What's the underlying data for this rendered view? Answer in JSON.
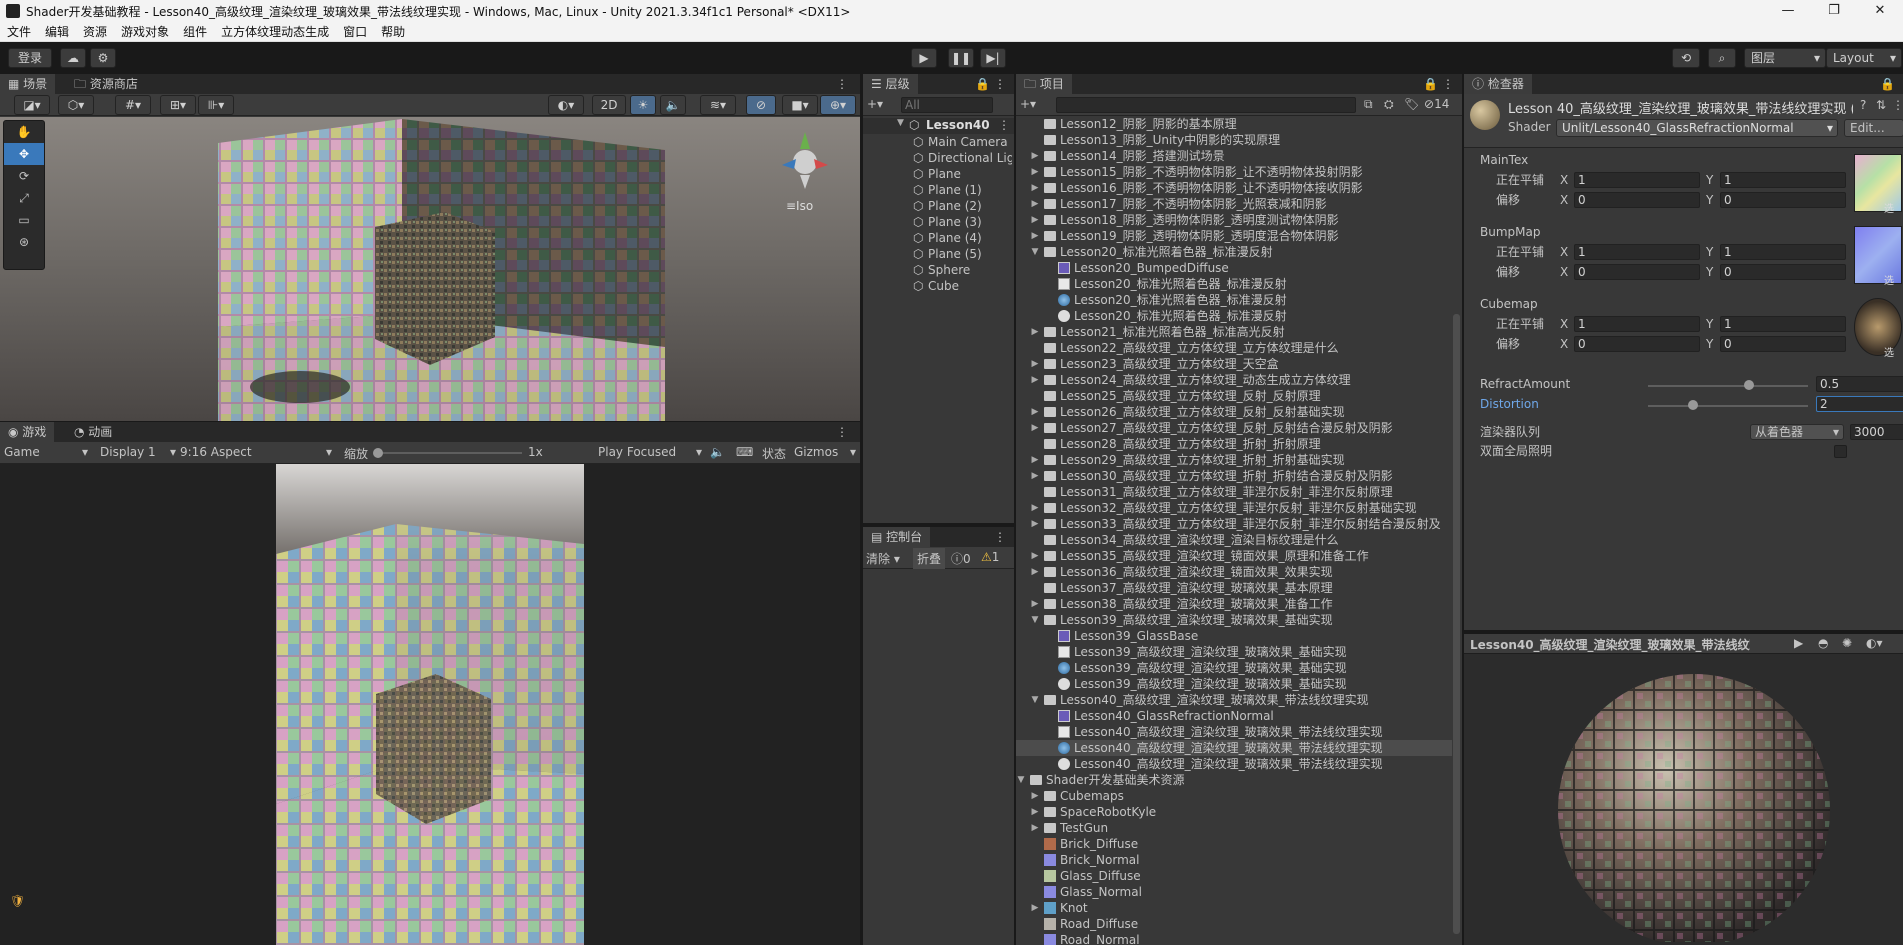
{
  "window": {
    "title": "Shader开发基础教程 - Lesson40_高级纹理_渲染纹理_玻璃效果_带法线纹理实现 - Windows, Mac, Linux - Unity 2021.3.34f1c1 Personal* <DX11>",
    "menu": [
      "文件",
      "编辑",
      "资源",
      "游戏对象",
      "组件",
      "立方体纹理动态生成",
      "窗口",
      "帮助"
    ]
  },
  "toolbar": {
    "login": "登录",
    "layers": "图层",
    "layout": "Layout"
  },
  "scene": {
    "tabs": [
      "场景",
      "资源商店"
    ],
    "mode_2d": "2D",
    "gizmo_label": "≡Iso",
    "search_placeholder": "All"
  },
  "game": {
    "tabs": [
      "游戏",
      "动画"
    ],
    "game_select": "Game",
    "display": "Display 1",
    "aspect": "9:16 Aspect",
    "scale_label": "缩放",
    "scale_value": "1x",
    "play_focused": "Play Focused",
    "stats": "状态",
    "gizmos": "Gizmos"
  },
  "hierarchy": {
    "tab": "层级",
    "search_placeholder": "All",
    "scene_name": "Lesson40",
    "items": [
      "Main Camera",
      "Directional Light",
      "Plane",
      "Plane (1)",
      "Plane (2)",
      "Plane (3)",
      "Plane (4)",
      "Plane (5)",
      "Sphere",
      "Cube"
    ]
  },
  "console": {
    "tab": "控制台",
    "clear": "清除",
    "collapse": "折叠",
    "errors": "0",
    "warnings": "1"
  },
  "project": {
    "tab": "项目",
    "hidden_count": "14",
    "rows": [
      {
        "d": 2,
        "fold": "",
        "icon": "folder",
        "text": "Lesson12_阴影_阴影的基本原理"
      },
      {
        "d": 2,
        "fold": "",
        "icon": "folder",
        "text": "Lesson13_阴影_Unity中阴影的实现原理"
      },
      {
        "d": 2,
        "fold": "▶",
        "icon": "folder",
        "text": "Lesson14_阴影_搭建测试场景"
      },
      {
        "d": 2,
        "fold": "▶",
        "icon": "folder",
        "text": "Lesson15_阴影_不透明物体阴影_让不透明物体投射阴影"
      },
      {
        "d": 2,
        "fold": "▶",
        "icon": "folder",
        "text": "Lesson16_阴影_不透明物体阴影_让不透明物体接收阴影"
      },
      {
        "d": 2,
        "fold": "▶",
        "icon": "folder",
        "text": "Lesson17_阴影_不透明物体阴影_光照衰减和阴影"
      },
      {
        "d": 2,
        "fold": "▶",
        "icon": "folder",
        "text": "Lesson18_阴影_透明物体阴影_透明度测试物体阴影"
      },
      {
        "d": 2,
        "fold": "▶",
        "icon": "folder",
        "text": "Lesson19_阴影_透明物体阴影_透明度混合物体阴影"
      },
      {
        "d": 2,
        "fold": "▼",
        "icon": "folder",
        "text": "Lesson20_标准光照着色器_标准漫反射"
      },
      {
        "d": 3,
        "fold": "",
        "icon": "shader",
        "text": "Lesson20_BumpedDiffuse"
      },
      {
        "d": 3,
        "fold": "",
        "icon": "script",
        "text": "Lesson20_标准光照着色器_标准漫反射"
      },
      {
        "d": 3,
        "fold": "",
        "icon": "material",
        "text": "Lesson20_标准光照着色器_标准漫反射"
      },
      {
        "d": 3,
        "fold": "",
        "icon": "scene",
        "text": "Lesson20_标准光照着色器_标准漫反射"
      },
      {
        "d": 2,
        "fold": "▶",
        "icon": "folder",
        "text": "Lesson21_标准光照着色器_标准高光反射"
      },
      {
        "d": 2,
        "fold": "",
        "icon": "folder",
        "text": "Lesson22_高级纹理_立方体纹理_立方体纹理是什么"
      },
      {
        "d": 2,
        "fold": "▶",
        "icon": "folder",
        "text": "Lesson23_高级纹理_立方体纹理_天空盒"
      },
      {
        "d": 2,
        "fold": "▶",
        "icon": "folder",
        "text": "Lesson24_高级纹理_立方体纹理_动态生成立方体纹理"
      },
      {
        "d": 2,
        "fold": "",
        "icon": "folder",
        "text": "Lesson25_高级纹理_立方体纹理_反射_反射原理"
      },
      {
        "d": 2,
        "fold": "▶",
        "icon": "folder",
        "text": "Lesson26_高级纹理_立方体纹理_反射_反射基础实现"
      },
      {
        "d": 2,
        "fold": "▶",
        "icon": "folder",
        "text": "Lesson27_高级纹理_立方体纹理_反射_反射结合漫反射及阴影"
      },
      {
        "d": 2,
        "fold": "",
        "icon": "folder",
        "text": "Lesson28_高级纹理_立方体纹理_折射_折射原理"
      },
      {
        "d": 2,
        "fold": "▶",
        "icon": "folder",
        "text": "Lesson29_高级纹理_立方体纹理_折射_折射基础实现"
      },
      {
        "d": 2,
        "fold": "▶",
        "icon": "folder",
        "text": "Lesson30_高级纹理_立方体纹理_折射_折射结合漫反射及阴影"
      },
      {
        "d": 2,
        "fold": "",
        "icon": "folder",
        "text": "Lesson31_高级纹理_立方体纹理_菲涅尔反射_菲涅尔反射原理"
      },
      {
        "d": 2,
        "fold": "▶",
        "icon": "folder",
        "text": "Lesson32_高级纹理_立方体纹理_菲涅尔反射_菲涅尔反射基础实现"
      },
      {
        "d": 2,
        "fold": "▶",
        "icon": "folder",
        "text": "Lesson33_高级纹理_立方体纹理_菲涅尔反射_菲涅尔反射结合漫反射及"
      },
      {
        "d": 2,
        "fold": "",
        "icon": "folder",
        "text": "Lesson34_高级纹理_渲染纹理_渲染目标纹理是什么"
      },
      {
        "d": 2,
        "fold": "▶",
        "icon": "folder",
        "text": "Lesson35_高级纹理_渲染纹理_镜面效果_原理和准备工作"
      },
      {
        "d": 2,
        "fold": "▶",
        "icon": "folder",
        "text": "Lesson36_高级纹理_渲染纹理_镜面效果_效果实现"
      },
      {
        "d": 2,
        "fold": "",
        "icon": "folder",
        "text": "Lesson37_高级纹理_渲染纹理_玻璃效果_基本原理"
      },
      {
        "d": 2,
        "fold": "▶",
        "icon": "folder",
        "text": "Lesson38_高级纹理_渲染纹理_玻璃效果_准备工作"
      },
      {
        "d": 2,
        "fold": "▼",
        "icon": "folder",
        "text": "Lesson39_高级纹理_渲染纹理_玻璃效果_基础实现"
      },
      {
        "d": 3,
        "fold": "",
        "icon": "shader",
        "text": "Lesson39_GlassBase"
      },
      {
        "d": 3,
        "fold": "",
        "icon": "script",
        "text": "Lesson39_高级纹理_渲染纹理_玻璃效果_基础实现"
      },
      {
        "d": 3,
        "fold": "",
        "icon": "material",
        "text": "Lesson39_高级纹理_渲染纹理_玻璃效果_基础实现"
      },
      {
        "d": 3,
        "fold": "",
        "icon": "scene",
        "text": "Lesson39_高级纹理_渲染纹理_玻璃效果_基础实现"
      },
      {
        "d": 2,
        "fold": "▼",
        "icon": "folder",
        "text": "Lesson40_高级纹理_渲染纹理_玻璃效果_带法线纹理实现"
      },
      {
        "d": 3,
        "fold": "",
        "icon": "shader",
        "text": "Lesson40_GlassRefractionNormal"
      },
      {
        "d": 3,
        "fold": "",
        "icon": "script",
        "text": "Lesson40_高级纹理_渲染纹理_玻璃效果_带法线纹理实现"
      },
      {
        "d": 3,
        "fold": "",
        "icon": "material",
        "text": "Lesson40_高级纹理_渲染纹理_玻璃效果_带法线纹理实现",
        "selected": true
      },
      {
        "d": 3,
        "fold": "",
        "icon": "scene",
        "text": "Lesson40_高级纹理_渲染纹理_玻璃效果_带法线纹理实现"
      },
      {
        "d": 1,
        "fold": "▼",
        "icon": "folder",
        "text": "Shader开发基础美术资源"
      },
      {
        "d": 2,
        "fold": "▶",
        "icon": "folder",
        "text": "Cubemaps"
      },
      {
        "d": 2,
        "fold": "▶",
        "icon": "folder",
        "text": "SpaceRobotKyle"
      },
      {
        "d": 2,
        "fold": "▶",
        "icon": "folder",
        "text": "TestGun"
      },
      {
        "d": 2,
        "fold": "",
        "icon": "brick",
        "text": "Brick_Diffuse"
      },
      {
        "d": 2,
        "fold": "",
        "icon": "normal",
        "text": "Brick_Normal"
      },
      {
        "d": 2,
        "fold": "",
        "icon": "glass",
        "text": "Glass_Diffuse"
      },
      {
        "d": 2,
        "fold": "",
        "icon": "normal",
        "text": "Glass_Normal"
      },
      {
        "d": 2,
        "fold": "▶",
        "icon": "mesh",
        "text": "Knot"
      },
      {
        "d": 2,
        "fold": "",
        "icon": "road",
        "text": "Road_Diffuse"
      },
      {
        "d": 2,
        "fold": "",
        "icon": "normal",
        "text": "Road_Normal"
      }
    ]
  },
  "inspector": {
    "tab": "检查器",
    "material_name": "Lesson 40_高级纹理_渲染纹理_玻璃效果_带法线纹理实现 (Ma",
    "shader_label": "Shader",
    "shader_value": "Unlit/Lesson40_GlassRefractionNormal",
    "edit": "Edit...",
    "tiling_label": "正在平铺",
    "offset_label": "偏移",
    "select_label": "选",
    "textures": [
      {
        "name": "MainTex",
        "tiling_x": "1",
        "tiling_y": "1",
        "offset_x": "0",
        "offset_y": "0"
      },
      {
        "name": "BumpMap",
        "tiling_x": "1",
        "tiling_y": "1",
        "offset_x": "0",
        "offset_y": "0"
      },
      {
        "name": "Cubemap",
        "tiling_x": "1",
        "tiling_y": "1",
        "offset_x": "0",
        "offset_y": "0"
      }
    ],
    "refract_label": "RefractAmount",
    "refract_value": "0.5",
    "distortion_label": "Distortion",
    "distortion_value": "2",
    "queue_label": "渲染器队列",
    "queue_mode": "从着色器",
    "queue_value": "3000",
    "double_sided": "双面全局照明",
    "preview_title": "Lesson40_高级纹理_渲染纹理_玻璃效果_带法线纹理实"
  },
  "colors": {
    "accent": "#3a79bb",
    "selected": "#2c5d87",
    "panel": "#383838"
  }
}
